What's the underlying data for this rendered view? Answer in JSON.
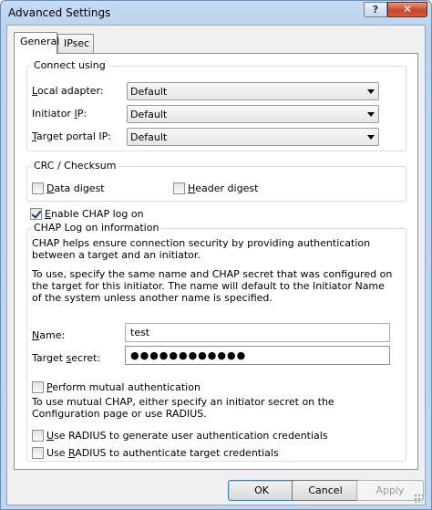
{
  "window": {
    "title": "Advanced Settings",
    "help_glyph": "?",
    "close_glyph": "✕"
  },
  "tabs": [
    {
      "label": "General",
      "active": true
    },
    {
      "label": "IPsec",
      "active": false
    }
  ],
  "connect_using": {
    "group_label": "Connect using",
    "local_adapter": {
      "label_pre": "",
      "label_u": "L",
      "label_post": "ocal adapter:",
      "value": "Default"
    },
    "initiator_ip": {
      "label_pre": "Initiator ",
      "label_u": "I",
      "label_post": "P:",
      "value": "Default"
    },
    "target_portal_ip": {
      "label_pre": "",
      "label_u": "T",
      "label_post": "arget portal IP:",
      "value": "Default"
    }
  },
  "crc": {
    "group_label": "CRC / Checksum",
    "data_digest": {
      "label_pre": "",
      "label_u": "D",
      "label_post": "ata digest",
      "checked": false
    },
    "header_digest": {
      "label_pre": "",
      "label_u": "H",
      "label_post": "eader digest",
      "checked": false
    }
  },
  "chap": {
    "enable": {
      "label_pre": "",
      "label_u": "E",
      "label_post": "nable CHAP log on",
      "checked": true
    },
    "group_label": "CHAP Log on information",
    "description_1": "CHAP helps ensure connection security by providing authentication between a target and an initiator.",
    "description_2": "To use, specify the same name and CHAP secret that was configured on the target for this initiator.  The name will default to the Initiator Name of the system unless another name is specified.",
    "name": {
      "label_pre": "",
      "label_u": "N",
      "label_post": "ame:",
      "value": "test"
    },
    "secret": {
      "label_pre": "Target ",
      "label_u": "s",
      "label_post": "ecret:",
      "value": "●●●●●●●●●●●●"
    },
    "mutual": {
      "label_pre": "",
      "label_u": "P",
      "label_post": "erform mutual authentication",
      "checked": false
    },
    "mutual_description": "To use mutual CHAP, either specify an initiator secret on the Configuration page or use RADIUS.",
    "radius_user": {
      "label_pre": "",
      "label_u": "U",
      "label_post": "se RADIUS to generate user authentication credentials",
      "checked": false
    },
    "radius_target": {
      "label_pre": "Use ",
      "label_u": "R",
      "label_post": "ADIUS to authenticate target credentials",
      "checked": false
    }
  },
  "buttons": {
    "ok": "OK",
    "cancel": "Cancel",
    "apply": "Apply"
  }
}
